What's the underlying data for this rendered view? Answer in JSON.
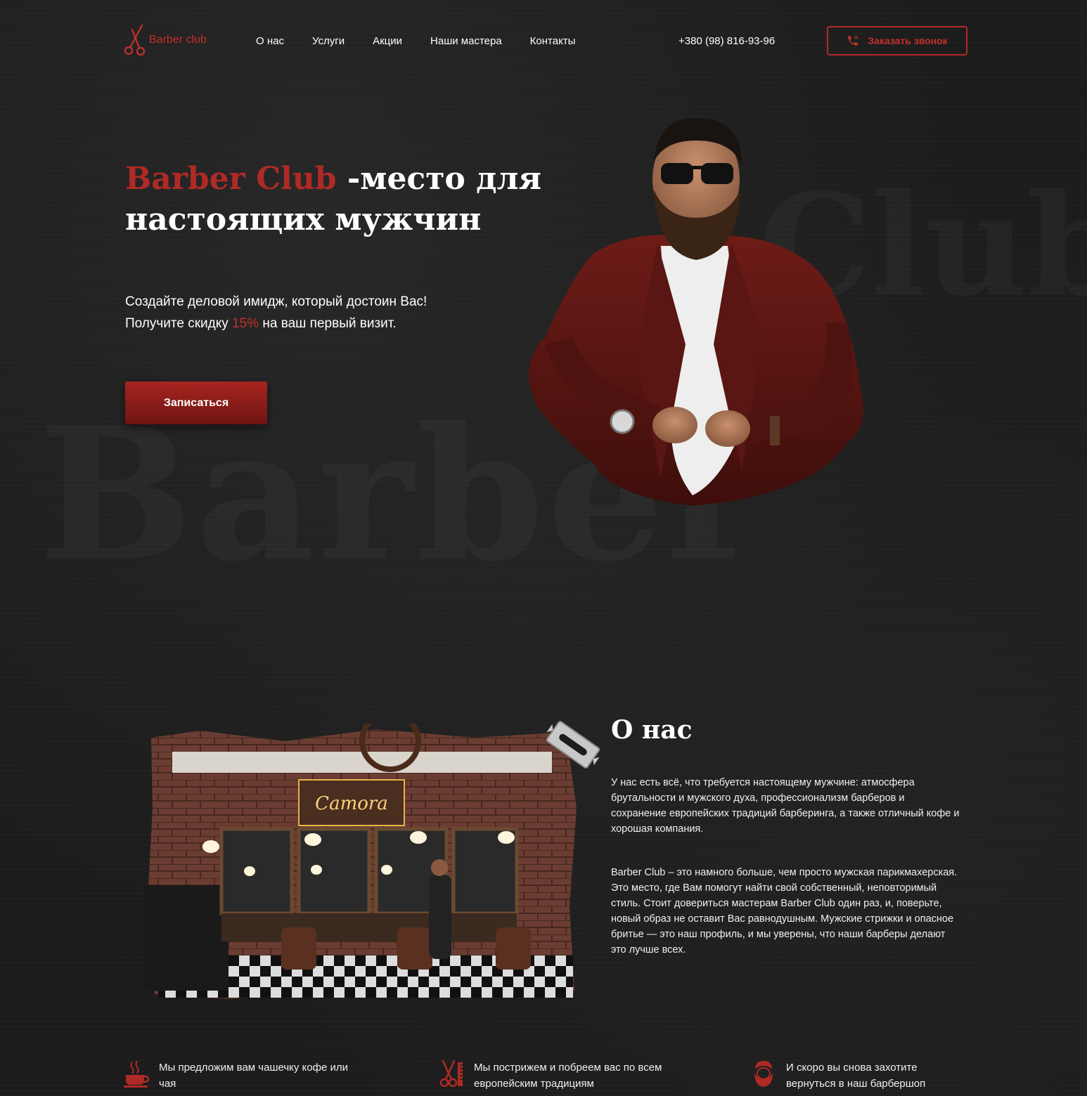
{
  "header": {
    "logo_text": "Barber club",
    "nav": [
      "О нас",
      "Услуги",
      "Акции",
      "Наши мастера",
      "Контакты"
    ],
    "phone": "+380 (98) 816-93-96",
    "call_button": "Заказать звонок"
  },
  "hero": {
    "title_accent": "Barber Club",
    "title_rest_1": " -место для",
    "title_rest_2": "настоящих мужчин",
    "sub_line1": "Создайте деловой имидж, который достоин Вас!",
    "sub_line2_before": "Получите скидку ",
    "sub_discount": "15%",
    "sub_line2_after": " на ваш первый визит.",
    "cta": "Записаться",
    "watermark_main": "Barber",
    "watermark_side": "Club"
  },
  "about": {
    "title": "О нас",
    "p1": "У нас есть всё, что требуется настоящему мужчине: атмосфера брутальности и мужского духа, профессионализм барберов и сохранение европейских традиций барберинга, а также отличный кофе и хорошая компания.",
    "p2": "Barber Club – это намного больше, чем просто мужская парикмахерская. Это место, где Вам помогут найти свой собственный, неповторимый стиль. Стоит довериться мастерам Barber Club один раз, и, поверьте, новый образ не оставит Вас равнодушным. Мужские стрижки и опасное бритье — это наш профиль, и мы уверены, что наши барберы делают это лучше всех.",
    "sign_text": "Camora"
  },
  "features": [
    {
      "icon": "coffee-cup-icon",
      "text": "Мы предложим вам чашечку кофе или чая"
    },
    {
      "icon": "scissors-comb-icon",
      "text": "Мы пострижем и побреем вас по всем европейским традициям"
    },
    {
      "icon": "bearded-man-icon",
      "text": "И скоро вы снова захотите вернуться в наш барбершоп"
    }
  ],
  "colors": {
    "accent": "#c4302b",
    "accent_dark": "#8a1c18",
    "background": "#1c1c1c"
  }
}
